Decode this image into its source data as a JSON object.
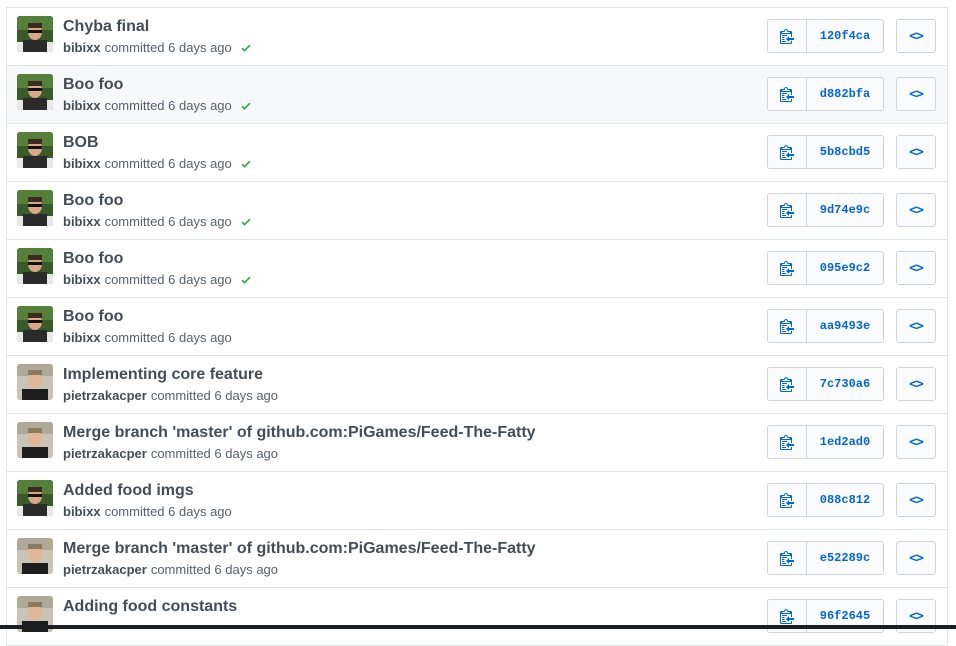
{
  "colors": {
    "link": "#0366d6",
    "success": "#28a745",
    "title": "#444d56",
    "meta": "#586069"
  },
  "icons": {
    "copy": "clippy-icon",
    "browse": "code-icon",
    "status": "check-icon"
  },
  "commits": [
    {
      "title": "Chyba final",
      "author": "bibixx",
      "time": "committed 6 days ago",
      "sha": "120f4ca",
      "check": true,
      "avatar": "bibixx"
    },
    {
      "title": "Boo foo",
      "author": "bibixx",
      "time": "committed 6 days ago",
      "sha": "d882bfa",
      "check": true,
      "avatar": "bibixx"
    },
    {
      "title": "BOB",
      "author": "bibixx",
      "time": "committed 6 days ago",
      "sha": "5b8cbd5",
      "check": true,
      "avatar": "bibixx"
    },
    {
      "title": "Boo foo",
      "author": "bibixx",
      "time": "committed 6 days ago",
      "sha": "9d74e9c",
      "check": true,
      "avatar": "bibixx"
    },
    {
      "title": "Boo foo",
      "author": "bibixx",
      "time": "committed 6 days ago",
      "sha": "095e9c2",
      "check": true,
      "avatar": "bibixx"
    },
    {
      "title": "Boo foo",
      "author": "bibixx",
      "time": "committed 6 days ago",
      "sha": "aa9493e",
      "check": false,
      "avatar": "bibixx"
    },
    {
      "title": "Implementing core feature",
      "author": "pietrzakacper",
      "time": "committed 6 days ago",
      "sha": "7c730a6",
      "check": false,
      "avatar": "pietrzakacper"
    },
    {
      "title": "Merge branch 'master' of github.com:PiGames/Feed-The-Fatty",
      "author": "pietrzakacper",
      "time": "committed 6 days ago",
      "sha": "1ed2ad0",
      "check": false,
      "avatar": "pietrzakacper"
    },
    {
      "title": "Added food imgs",
      "author": "bibixx",
      "time": "committed 6 days ago",
      "sha": "088c812",
      "check": false,
      "avatar": "bibixx"
    },
    {
      "title": "Merge branch 'master' of github.com:PiGames/Feed-The-Fatty",
      "author": "pietrzakacper",
      "time": "committed 6 days ago",
      "sha": "e52289c",
      "check": false,
      "avatar": "pietrzakacper"
    },
    {
      "title": "Adding food constants",
      "author": "",
      "time": "",
      "sha": "96f2645",
      "check": false,
      "avatar": "pietrzakacper"
    }
  ]
}
